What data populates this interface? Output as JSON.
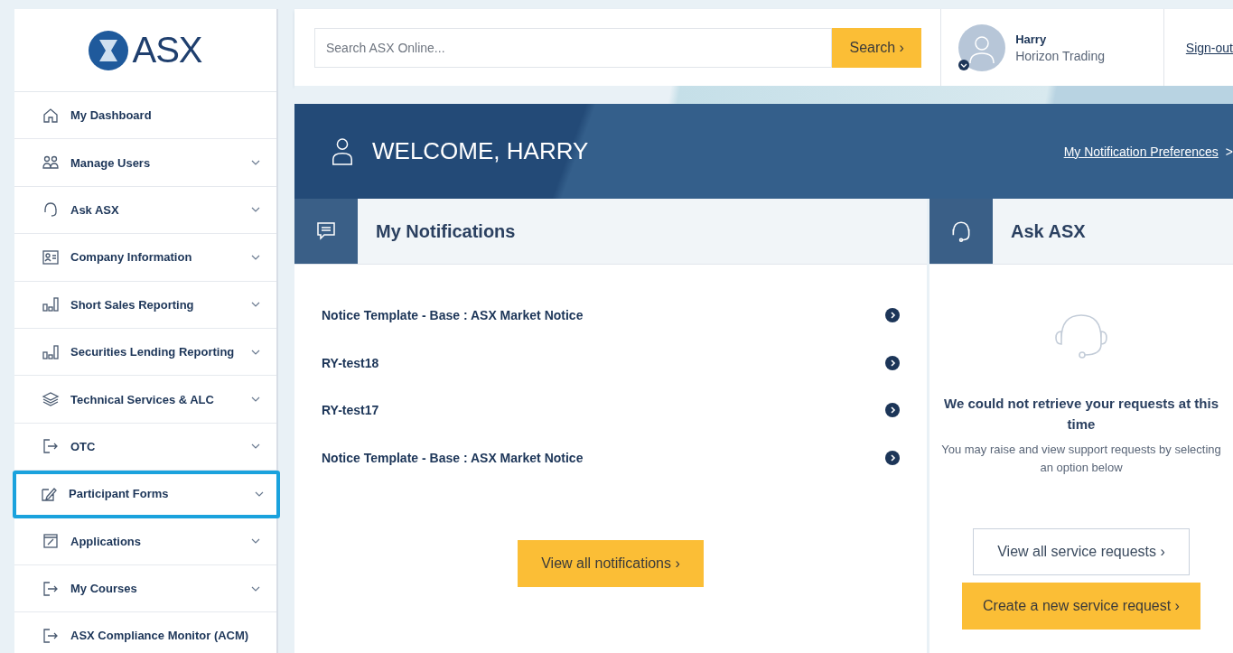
{
  "logo": {
    "text": "ASX"
  },
  "sidebar": {
    "items": [
      {
        "label": "My Dashboard",
        "expandable": false,
        "selected": false
      },
      {
        "label": "Manage Users",
        "expandable": true,
        "selected": false
      },
      {
        "label": "Ask ASX",
        "expandable": true,
        "selected": false
      },
      {
        "label": "Company Information",
        "expandable": true,
        "selected": false
      },
      {
        "label": "Short Sales Reporting",
        "expandable": true,
        "selected": false
      },
      {
        "label": "Securities Lending Reporting",
        "expandable": true,
        "selected": false
      },
      {
        "label": "Technical Services & ALC",
        "expandable": true,
        "selected": false
      },
      {
        "label": "OTC",
        "expandable": true,
        "selected": false
      },
      {
        "label": "Participant Forms",
        "expandable": true,
        "selected": true
      },
      {
        "label": "Applications",
        "expandable": true,
        "selected": false
      },
      {
        "label": "My Courses",
        "expandable": true,
        "selected": false
      },
      {
        "label": "ASX Compliance Monitor (ACM)",
        "expandable": false,
        "selected": false
      }
    ]
  },
  "search": {
    "placeholder": "Search ASX Online...",
    "button": "Search ›"
  },
  "user": {
    "name": "Harry",
    "company": "Horizon Trading",
    "sign_out": "Sign-out"
  },
  "welcome": {
    "title": "WELCOME, HARRY",
    "link": "My Notification Preferences",
    "link_arrow": ">"
  },
  "notifications": {
    "title": "My Notifications",
    "items": [
      "Notice Template - Base : ASX Market Notice",
      "RY-test18",
      "RY-test17",
      "Notice Template - Base : ASX Market Notice"
    ],
    "button": "View all notifications ›"
  },
  "ask_asx": {
    "title": "Ask ASX",
    "message": "We could not retrieve your requests at this time",
    "hint": "You may raise and view support requests by selecting an option below",
    "buttons": [
      {
        "label": "View all service requests ›",
        "kind": "outline"
      },
      {
        "label": "Create a new service request ›",
        "kind": "primary"
      }
    ]
  }
}
